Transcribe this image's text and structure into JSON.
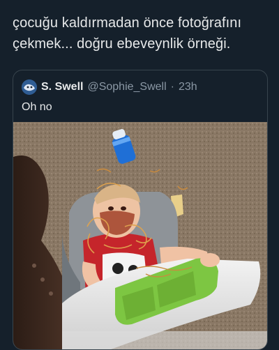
{
  "caption": "çocuğu kaldırmadan önce fotoğrafını çekmek... doğru ebeveynlik örneği.",
  "quoted_tweet": {
    "author_name": "S. Swell",
    "author_handle": "@Sophie_Swell",
    "separator": "·",
    "time": "23h",
    "text": "Oh no"
  },
  "icons": {
    "avatar": "profile-avatar"
  },
  "colors": {
    "background": "#15202b",
    "card_border": "#38444d",
    "secondary_text": "#8b98a5"
  }
}
